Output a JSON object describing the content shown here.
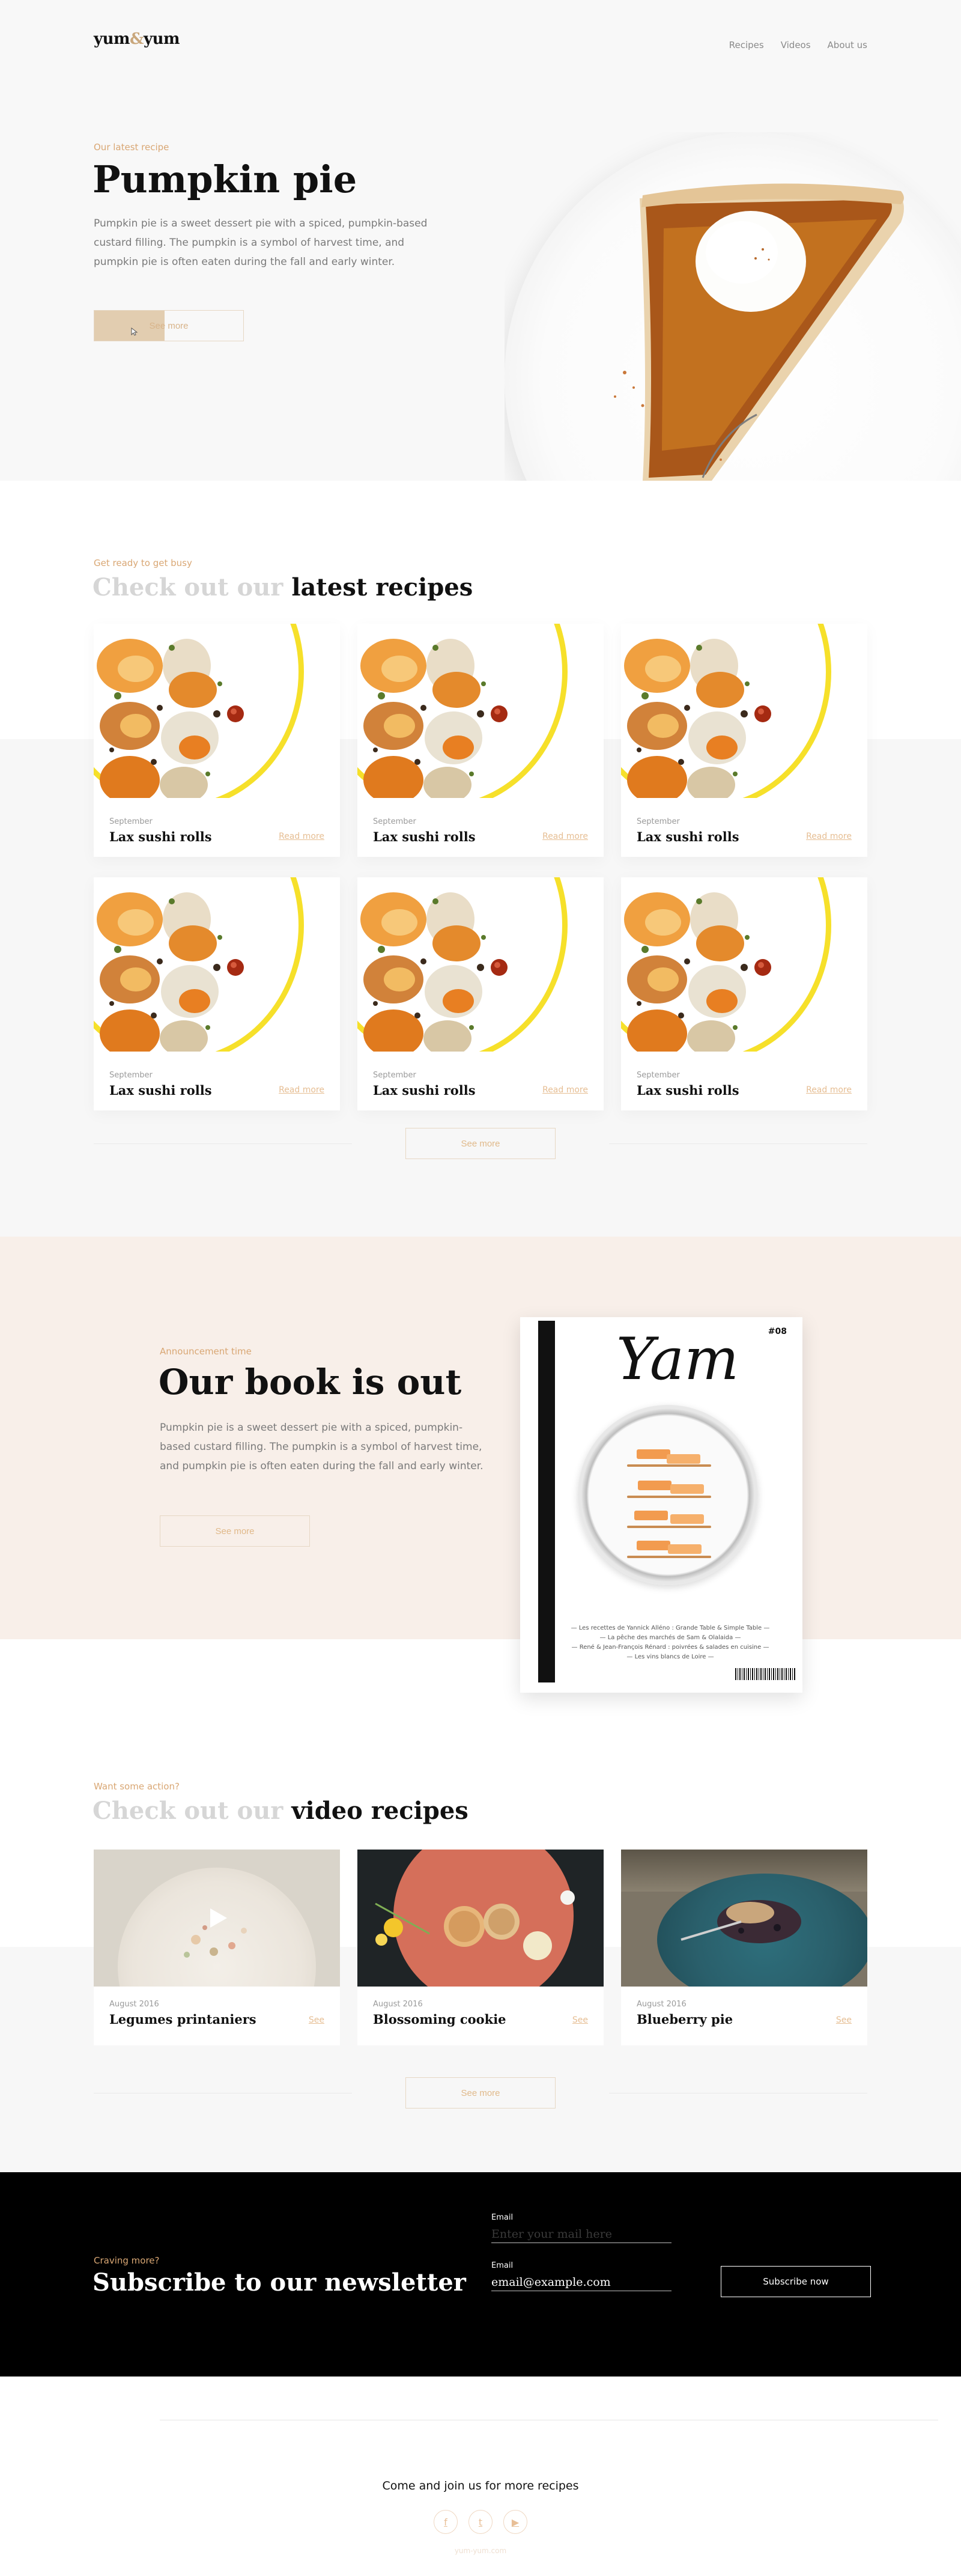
{
  "header": {
    "logo_left": "yum",
    "logo_amp": "&",
    "logo_right": "yum",
    "nav": [
      "Recipes",
      "Videos",
      "About us"
    ]
  },
  "hero": {
    "eyebrow": "Our latest recipe",
    "title": "Pumpkin pie",
    "description": "Pumpkin pie is a sweet dessert pie with a spiced, pumpkin-based custard filling. The pumpkin is a symbol of harvest time, and pumpkin pie is often eaten during the fall and early winter.",
    "button": "See more",
    "button_progress": 0.47
  },
  "latest": {
    "eyebrow": "Get ready to get busy",
    "title_muted": "Check out our",
    "title_strong": "latest recipes",
    "cards": [
      {
        "date": "September",
        "name": "Lax sushi rolls",
        "link": "Read more"
      },
      {
        "date": "September",
        "name": "Lax sushi rolls",
        "link": "Read more"
      },
      {
        "date": "September",
        "name": "Lax sushi rolls",
        "link": "Read more"
      },
      {
        "date": "September",
        "name": "Lax sushi rolls",
        "link": "Read more"
      },
      {
        "date": "September",
        "name": "Lax sushi rolls",
        "link": "Read more"
      },
      {
        "date": "September",
        "name": "Lax sushi rolls",
        "link": "Read more"
      }
    ],
    "see_more": "See more"
  },
  "book": {
    "eyebrow": "Announcement time",
    "title": "Our book is out",
    "description": "Pumpkin pie is a sweet dessert pie with a spiced, pumpkin-based custard filling. The pumpkin is a symbol of harvest time, and pumpkin pie is often eaten during the fall and early winter.",
    "button": "See more",
    "cover_title": "Yam",
    "cover_issue": "#08",
    "cover_lines": [
      "— Les recettes de Yannick Alléno : Grande Table & Simple Table —",
      "— La pêche des marchés de Sam & Olalaida —",
      "— René & Jean-François Rénard : poivrées & salades en cuisine —",
      "— Les vins blancs de Loire —"
    ]
  },
  "videos": {
    "eyebrow": "Want some action?",
    "title_muted": "Check out our",
    "title_strong": "video recipes",
    "cards": [
      {
        "date": "August 2016",
        "name": "Legumes printaniers",
        "link": "See"
      },
      {
        "date": "August 2016",
        "name": "Blossoming cookie",
        "link": "See"
      },
      {
        "date": "August 2016",
        "name": "Blueberry pie",
        "link": "See"
      }
    ],
    "see_more": "See more"
  },
  "newsletter": {
    "eyebrow": "Craving more?",
    "title": "Subscribe to our newsletter",
    "field1_label": "Email",
    "field1_placeholder": "Enter your mail here",
    "field2_label": "Email",
    "field2_value": "email@example.com",
    "button": "Subscribe now"
  },
  "footer": {
    "text": "Come and join us for more recipes",
    "social_icons": [
      "facebook-icon",
      "twitter-icon",
      "youtube-icon"
    ],
    "social_glyphs": [
      "f",
      "t",
      "▶"
    ],
    "copyright": "yum-yum.com"
  },
  "colors": {
    "accent": "#d9a774",
    "hero_bg": "#f8f8f8",
    "book_bg": "#f8efe9",
    "newsletter_bg": "#000000"
  }
}
